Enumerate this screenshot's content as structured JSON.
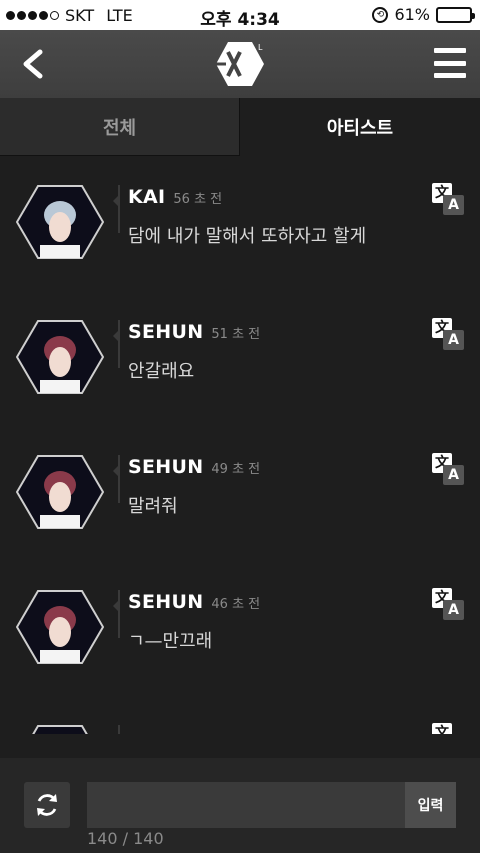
{
  "status_bar": {
    "carrier": "SKT",
    "network": "LTE",
    "time": "오후 4:34",
    "battery": "61%",
    "battery_level": 0.61
  },
  "nav": {
    "back_icon": "chevron-left-icon",
    "menu_icon": "hamburger-menu-icon",
    "logo_icon": "exo-logo-icon"
  },
  "tabs": [
    {
      "label": "전체",
      "active": false
    },
    {
      "label": "아티스트",
      "active": true
    }
  ],
  "messages": [
    {
      "name": "KAI",
      "time": "56 초 전",
      "text": "담에 내가 말해서 또하자고 할게",
      "avatar_color": "#b9c8d6"
    },
    {
      "name": "SEHUN",
      "time": "51 초 전",
      "text": "안갈래요",
      "avatar_color": "#8a3a4a"
    },
    {
      "name": "SEHUN",
      "time": "49 초 전",
      "text": "말려줘",
      "avatar_color": "#8a3a4a"
    },
    {
      "name": "SEHUN",
      "time": "46 초 전",
      "text": "ㄱ—만끄래",
      "avatar_color": "#8a3a4a"
    }
  ],
  "translate": {
    "glyph_top": "文",
    "glyph_bottom": "A"
  },
  "input": {
    "value": "",
    "placeholder": "",
    "submit_label": "입력",
    "char_count": "140 / 140"
  }
}
